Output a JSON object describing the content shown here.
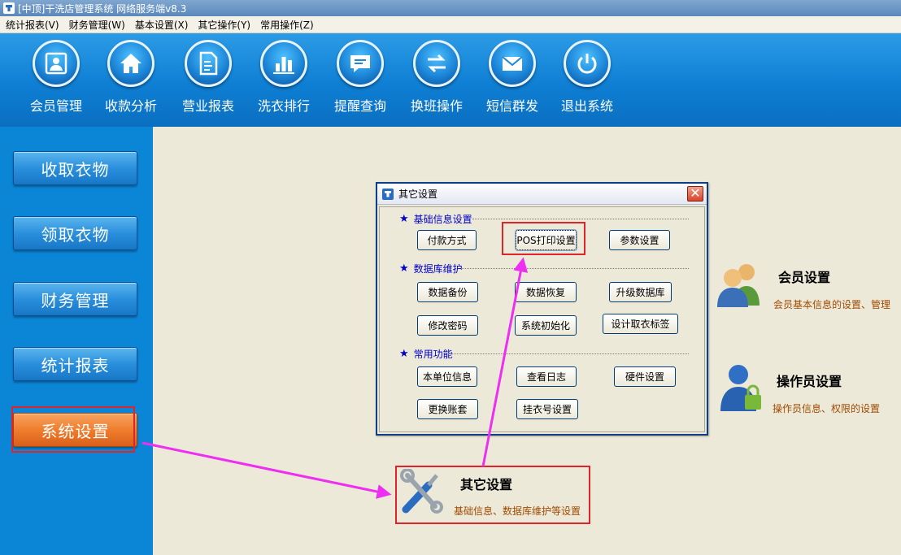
{
  "window": {
    "title": "[中顶]干洗店管理系统 网络服务端v8.3"
  },
  "menu": [
    {
      "label": "统计报表(V)"
    },
    {
      "label": "财务管理(W)"
    },
    {
      "label": "基本设置(X)"
    },
    {
      "label": "其它操作(Y)"
    },
    {
      "label": "常用操作(Z)"
    }
  ],
  "toolbar": [
    {
      "label": "会员管理",
      "icon": "member-icon"
    },
    {
      "label": "收款分析",
      "icon": "home-icon"
    },
    {
      "label": "营业报表",
      "icon": "report-icon"
    },
    {
      "label": "洗衣排行",
      "icon": "bar-chart-icon"
    },
    {
      "label": "提醒查询",
      "icon": "message-icon"
    },
    {
      "label": "换班操作",
      "icon": "swap-icon"
    },
    {
      "label": "短信群发",
      "icon": "sms-icon"
    },
    {
      "label": "退出系统",
      "icon": "power-icon"
    }
  ],
  "sidebar": [
    {
      "label": "收取衣物"
    },
    {
      "label": "领取衣物"
    },
    {
      "label": "财务管理"
    },
    {
      "label": "统计报表"
    },
    {
      "label": "系统设置",
      "active": true
    }
  ],
  "dialog": {
    "title": "其它设置",
    "close": "✕",
    "sections": [
      {
        "title": "基础信息设置",
        "buttons": [
          "付款方式",
          "POS打印设置",
          "参数设置"
        ]
      },
      {
        "title": "数据库维护",
        "buttons": [
          "数据备份",
          "数据恢复",
          "升级数据库",
          "修改密码",
          "系统初始化",
          "设计取衣标签"
        ]
      },
      {
        "title": "常用功能",
        "buttons": [
          "本单位信息",
          "查看日志",
          "硬件设置",
          "更换账套",
          "挂衣号设置"
        ]
      }
    ],
    "star": "★"
  },
  "settings": {
    "member": {
      "title": "会员设置",
      "desc": "会员基本信息的设置、管理",
      "icon": "users-icon"
    },
    "operator": {
      "title": "操作员设置",
      "desc": "操作员信息、权限的设置",
      "icon": "operator-lock-icon"
    },
    "other": {
      "title": "其它设置",
      "desc": "基础信息、数据库维护等设置",
      "icon": "tools-icon"
    }
  },
  "colors": {
    "toolbar_bg": "#0e7fd4",
    "sidebar_bg": "#0b85d6",
    "active_button": "#ee7a2a",
    "highlight": "#e0242c",
    "arrow": "#ee2ef0"
  }
}
